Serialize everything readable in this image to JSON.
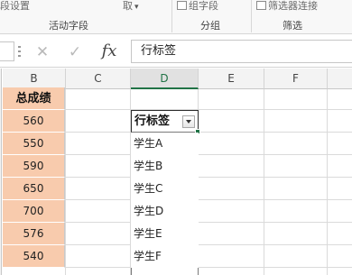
{
  "ribbon": {
    "partial_button_1": "段设置",
    "group_active_field": "活动字段",
    "partial_button_2": "取",
    "partial_arrow": "▾",
    "group_field_button": "组字段",
    "group_group": "分组",
    "slicer_connect": "筛选器连接",
    "group_filter": "筛选"
  },
  "formula_bar": {
    "cancel_glyph": "✕",
    "enter_glyph": "✓",
    "fx_label": "fx",
    "value": "行标签"
  },
  "columns": [
    "B",
    "C",
    "D",
    "E",
    "F"
  ],
  "active_column": "D",
  "sheet": {
    "b_header": "总成绩",
    "b_values": [
      "560",
      "550",
      "590",
      "650",
      "700",
      "576",
      "540"
    ],
    "pivot_header": "行标签",
    "pivot_items": [
      "学生A",
      "学生B",
      "学生C",
      "学生D",
      "学生E",
      "学生F"
    ]
  },
  "colors": {
    "accent": "#217346",
    "score_fill": "#f8cbad"
  }
}
